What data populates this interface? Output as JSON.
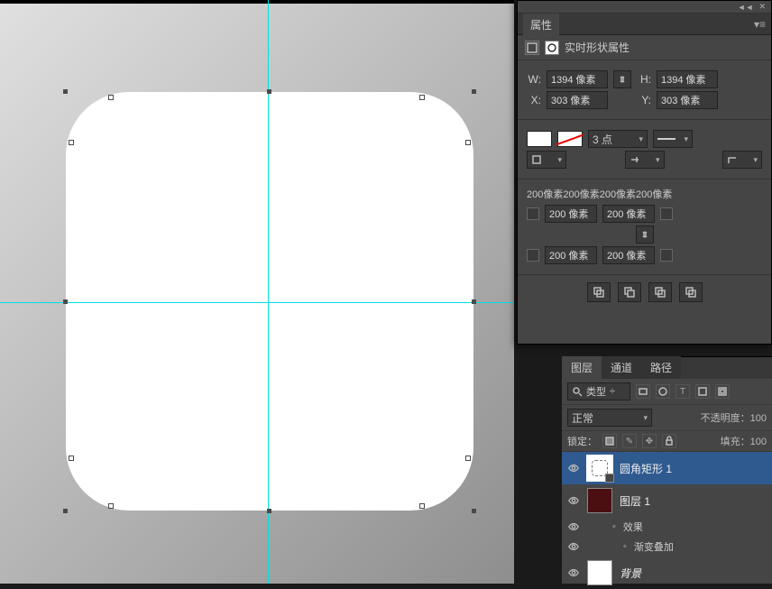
{
  "properties_panel": {
    "tab": "属性",
    "section_title": "实时形状属性",
    "W_label": "W:",
    "W": "1394 像素",
    "H_label": "H:",
    "H": "1394 像素",
    "X_label": "X:",
    "X": "303 像素",
    "Y_label": "Y:",
    "Y": "303 像素",
    "stroke_size": "3 点",
    "radius_summary": "200像素200像素200像素200像素",
    "r_tl": "200 像素",
    "r_tr": "200 像素",
    "r_bl": "200 像素",
    "r_br": "200 像素"
  },
  "layers_panel": {
    "tabs": {
      "layers": "图层",
      "channels": "通道",
      "paths": "路径"
    },
    "filter_kind": "类型",
    "blend_mode": "正常",
    "opacity_label": "不透明度：",
    "opacity": "100",
    "lock_label": "锁定：",
    "fill_label": "填充：",
    "fill": "100",
    "layer_shape": "圆角矩形 1",
    "layer1": "图层 1",
    "fx": "效果",
    "fx_item": "渐变叠加",
    "bg": "背景"
  }
}
